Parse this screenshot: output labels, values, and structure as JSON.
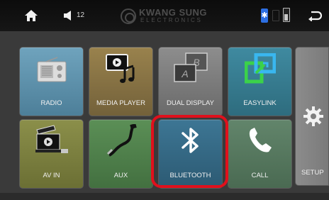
{
  "status_bar": {
    "home_icon": "home-icon",
    "volume_icon": "speaker-icon",
    "volume_level": "12",
    "brand_line1": "KWANG SUNG",
    "brand_line2": "ELECTRONICS",
    "bluetooth_status_icon": "bluetooth-icon",
    "usb_status_icon": "usb-icon",
    "sd_card_icon": "sd-card-icon",
    "back_icon": "back-arrow-icon",
    "colors": {
      "bluetooth_active": "#2d6fe3",
      "bar_bg": "#111111"
    }
  },
  "apps": [
    {
      "id": "radio",
      "label": "RADIO",
      "icon": "radio-icon"
    },
    {
      "id": "media-player",
      "label": "MEDIA PLAYER",
      "icon": "media-player-icon"
    },
    {
      "id": "dual-display",
      "label": "DUAL DISPLAY",
      "icon": "dual-display-icon"
    },
    {
      "id": "easylink",
      "label": "EASYLINK",
      "icon": "easylink-icon"
    },
    {
      "id": "av-in",
      "label": "AV IN",
      "icon": "av-in-icon"
    },
    {
      "id": "aux",
      "label": "AUX",
      "icon": "aux-cable-icon"
    },
    {
      "id": "bluetooth",
      "label": "BLUETOOTH",
      "icon": "bluetooth-icon",
      "highlighted": true
    },
    {
      "id": "call",
      "label": "CALL",
      "icon": "phone-icon"
    }
  ],
  "setup": {
    "label": "SETUP",
    "icon": "gear-icon"
  },
  "dual_display_letters": {
    "back": "B",
    "front": "A"
  },
  "highlight_color": "#e0101c"
}
